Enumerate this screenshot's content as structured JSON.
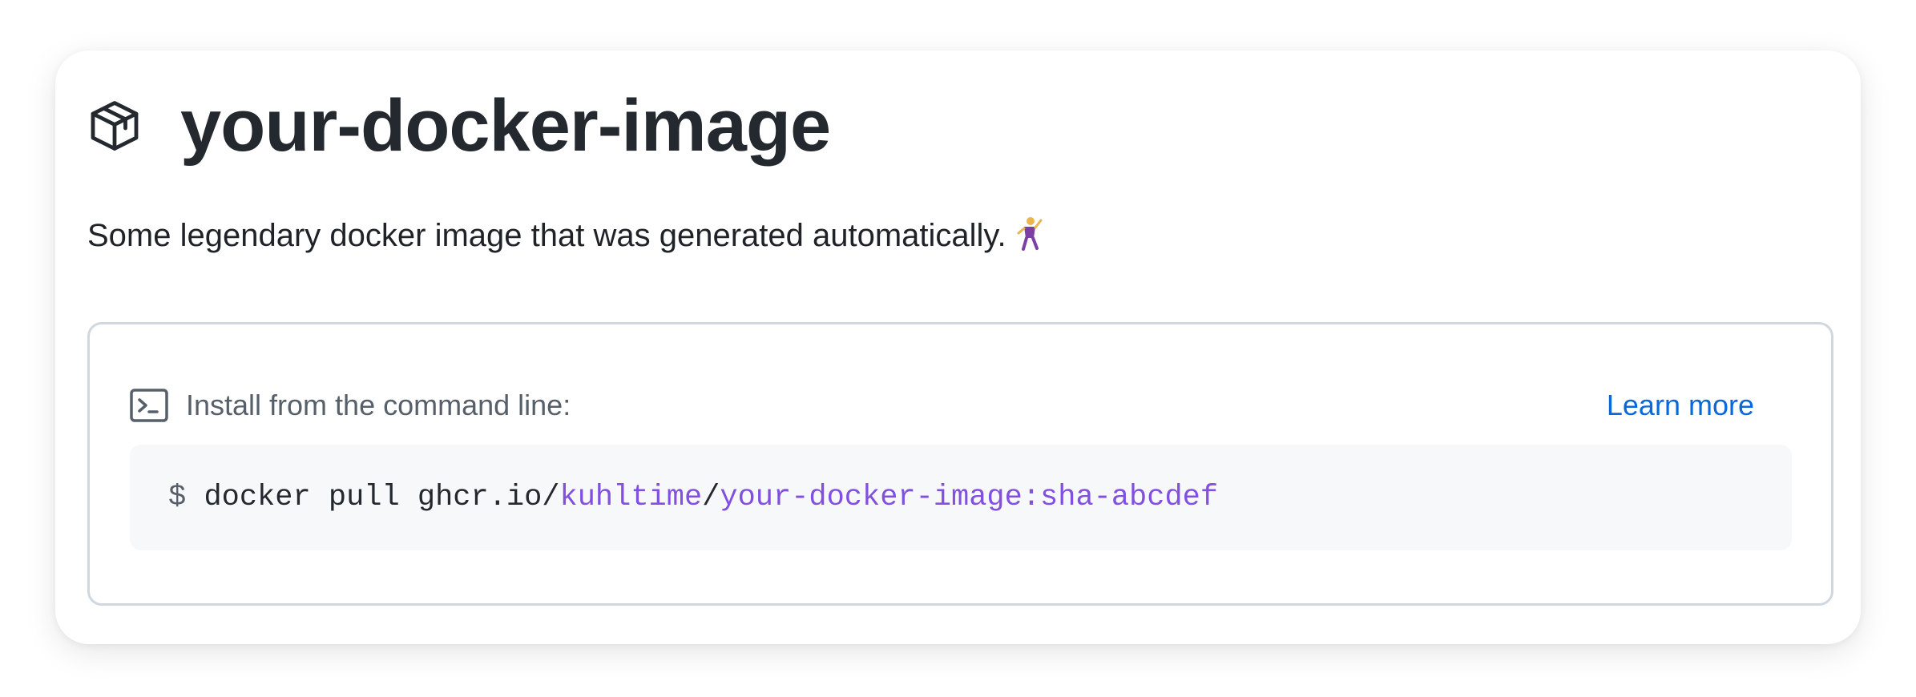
{
  "package": {
    "title": "your-docker-image",
    "icon": "package-icon",
    "description": "Some legendary docker image that was generated automatically.",
    "description_emoji": "🕺"
  },
  "install": {
    "icon": "terminal-icon",
    "label": "Install from the command line:",
    "learn_more": "Learn more",
    "command": {
      "prompt": "$",
      "base": "docker pull ghcr.io/",
      "owner": "kuhltime",
      "separator": "/",
      "image": "your-docker-image:sha-abcdef"
    }
  },
  "colors": {
    "title": "#24292f",
    "link": "#0969da",
    "accent": "#8250df",
    "code_bg": "#f6f8fa",
    "border": "#d0d7de"
  }
}
